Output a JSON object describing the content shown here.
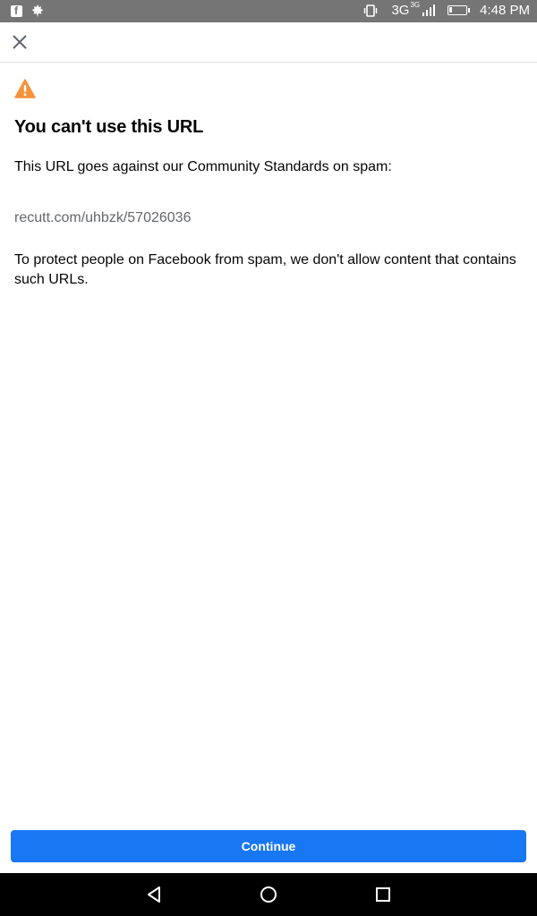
{
  "status_bar": {
    "left_icons": [
      "facebook-icon",
      "leaf-icon"
    ],
    "network": "3G",
    "network_sup": "3G",
    "time": "4:48 PM"
  },
  "header": {
    "close_icon": "close-icon"
  },
  "warning": {
    "icon": "warning-icon",
    "color": "#f7923b",
    "title": "You can't use this URL",
    "message": "This URL goes against our Community Standards on spam:",
    "url": "recutt.com/uhbzk/57026036",
    "explanation": "To protect people on Facebook from spam, we don't allow content that contains such URLs."
  },
  "actions": {
    "continue_label": "Continue",
    "accent": "#1877f2"
  },
  "nav_bar": {
    "buttons": [
      "back-icon",
      "home-icon",
      "recents-icon"
    ]
  }
}
